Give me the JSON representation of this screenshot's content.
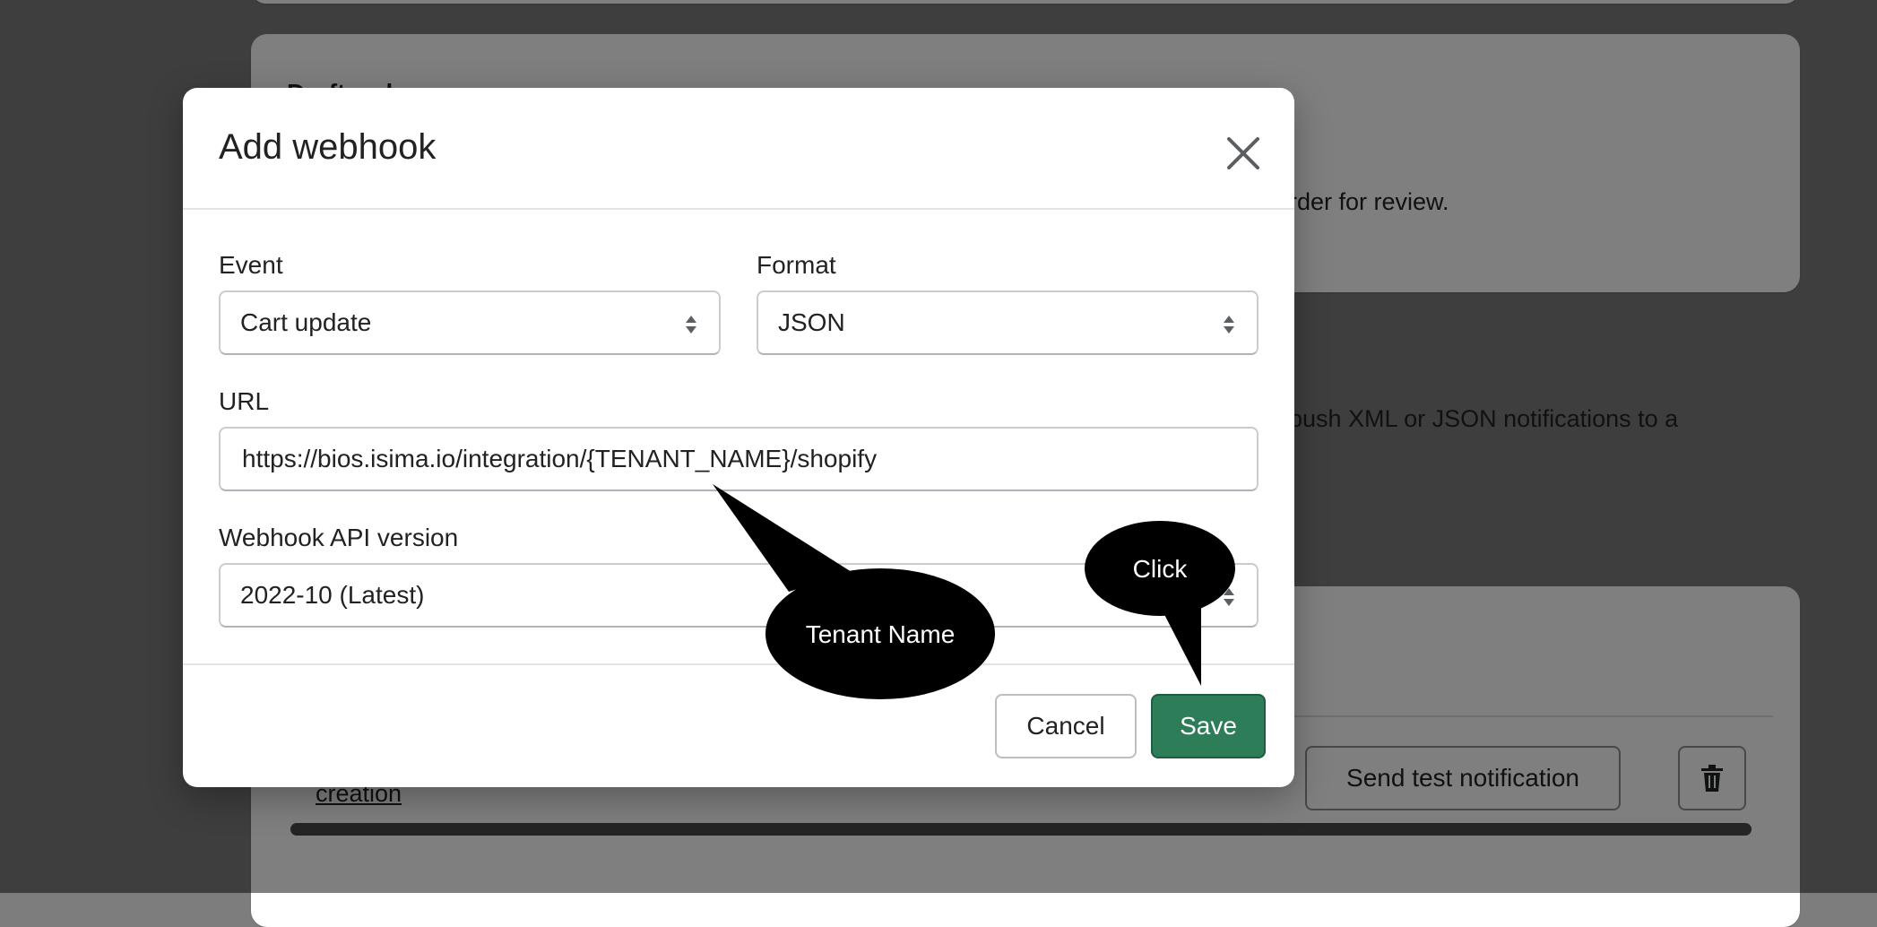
{
  "background": {
    "draft_orders_heading": "Draft orders",
    "draft_orders_text": "rder for review.",
    "webhooks_text": "push XML or JSON notifications to a",
    "row_link": "creation",
    "send_test_label": "Send test notification",
    "delete_icon": "trash-icon"
  },
  "modal": {
    "title": "Add webhook",
    "close_icon": "close-icon",
    "event": {
      "label": "Event",
      "value": "Cart update"
    },
    "format": {
      "label": "Format",
      "value": "JSON"
    },
    "url": {
      "label": "URL",
      "value": "https://bios.isima.io/integration/{TENANT_NAME}/shopify"
    },
    "api_version": {
      "label": "Webhook API version",
      "value": "2022-10 (Latest)"
    },
    "cancel_label": "Cancel",
    "save_label": "Save"
  },
  "callouts": {
    "tenant_name": "Tenant  Name",
    "click": "Click"
  },
  "colors": {
    "save_button": "#2e7d59",
    "callout": "#000000",
    "overlay": "rgba(0,0,0,0.5)"
  }
}
